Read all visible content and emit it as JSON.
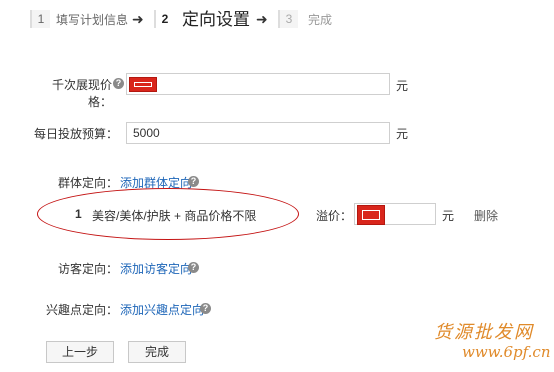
{
  "steps": [
    {
      "number": "1",
      "label": "填写计划信息"
    },
    {
      "number": "2",
      "label": "定向设置"
    },
    {
      "number": "3",
      "label": "完成"
    }
  ],
  "arrow_glyph": "➜",
  "form": {
    "cpm_price": {
      "label": "千次展现价格",
      "value": "",
      "unit": "元"
    },
    "daily_budget": {
      "label": "每日投放预算",
      "value": "5000",
      "unit": "元"
    },
    "crowd_targeting": {
      "label": "群体定向：",
      "add_link": "添加群体定向"
    },
    "crowd_item": {
      "index": "1",
      "description": "美容/美体/护肤 + 商品价格不限",
      "premium_label": "溢价：",
      "premium_value": "",
      "premium_unit": "元",
      "delete_label": "删除"
    },
    "visitor_targeting": {
      "label": "访客定向：",
      "add_link": "添加访客定向"
    },
    "interest_targeting": {
      "label": "兴趣点定向：",
      "add_link": "添加兴趣点定向"
    }
  },
  "buttons": {
    "prev": "上一步",
    "finish": "完成"
  },
  "help_glyph": "?",
  "required_colon": "：",
  "watermark": {
    "line1": "货源批发网",
    "line2": "www.6pf.cn"
  },
  "colors": {
    "link": "#1e66b8",
    "redaction": "#d9261c",
    "annotation": "#c41414",
    "watermark": "#e08a2a"
  }
}
